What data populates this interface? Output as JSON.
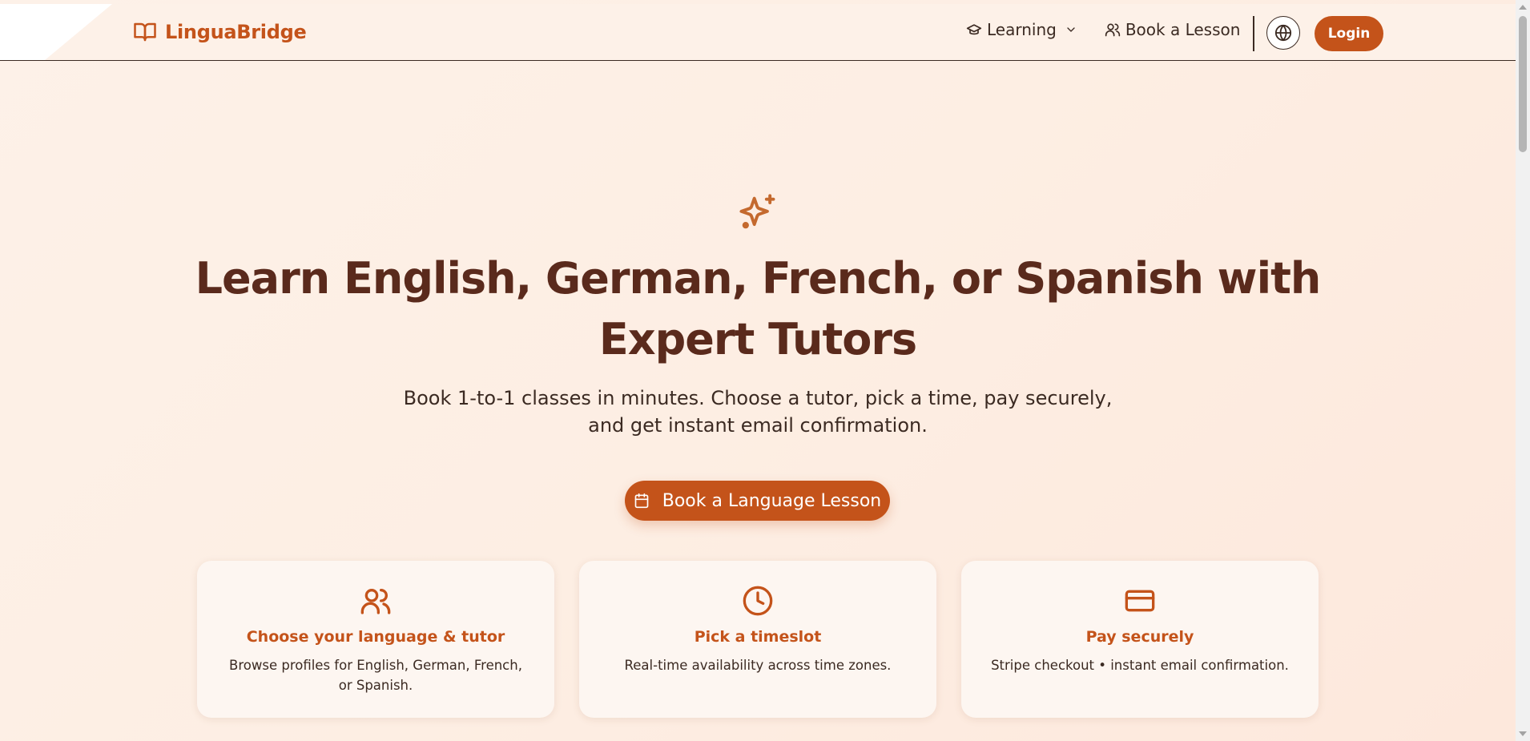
{
  "brand": {
    "name": "LinguaBridge",
    "icon": "open-book-icon"
  },
  "nav": {
    "learning_label": "Learning",
    "learning_icon": "graduation-cap-icon",
    "book_label": "Book a Lesson",
    "book_icon": "users-icon",
    "language_icon": "globe-icon",
    "login_label": "Login"
  },
  "hero": {
    "icon": "sparkles-icon",
    "title": "Learn English, German, French, or Spanish with Expert Tutors",
    "subtitle": "Book 1-to-1 classes in minutes. Choose a tutor, pick a time, pay securely, and get instant email confirmation.",
    "cta_label": "Book a Language Lesson",
    "cta_icon": "calendar-icon"
  },
  "features": [
    {
      "icon": "users-icon",
      "title": "Choose your language & tutor",
      "description": "Browse profiles for English, German, French, or Spanish."
    },
    {
      "icon": "clock-icon",
      "title": "Pick a timeslot",
      "description": "Real-time availability across time zones."
    },
    {
      "icon": "credit-card-icon",
      "title": "Pay securely",
      "description": "Stripe checkout • instant email confirmation."
    }
  ],
  "colors": {
    "accent": "#c4531a",
    "heading": "#5a2a1c",
    "text": "#3b2a22",
    "background": "#fdf1e8"
  }
}
